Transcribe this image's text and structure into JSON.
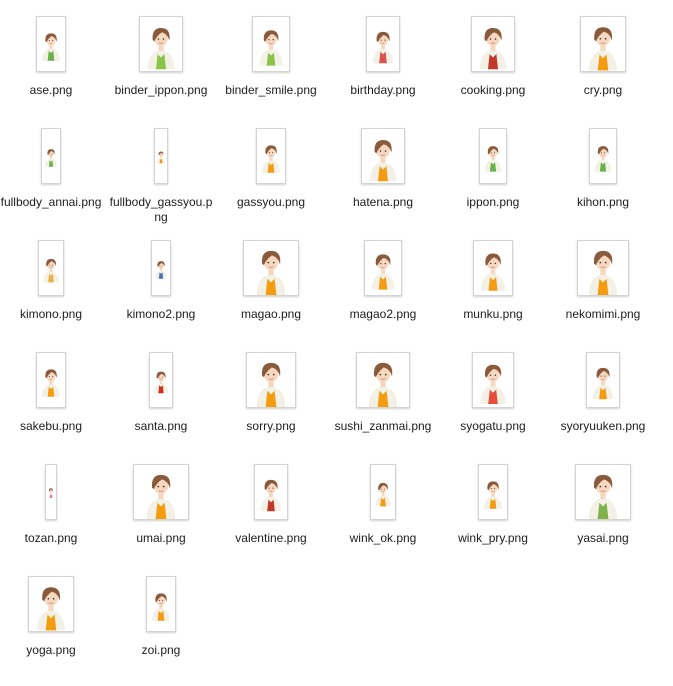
{
  "files": [
    {
      "name": "ase.png",
      "icon": "woman-portrait-green",
      "accent": "#6ab04c"
    },
    {
      "name": "binder_ippon.png",
      "icon": "woman-binder-pointing",
      "accent": "#8bc34a"
    },
    {
      "name": "binder_smile.png",
      "icon": "woman-binder-smile",
      "accent": "#8bc34a"
    },
    {
      "name": "birthday.png",
      "icon": "woman-birthday-cake",
      "accent": "#d9534f"
    },
    {
      "name": "cooking.png",
      "icon": "woman-cooking-pot",
      "accent": "#c0392b"
    },
    {
      "name": "cry.png",
      "icon": "woman-crying",
      "accent": "#f39c12"
    },
    {
      "name": "fullbody_annai.png",
      "icon": "woman-fullbody-guide",
      "accent": "#6ab04c"
    },
    {
      "name": "fullbody_gassyou.png",
      "icon": "woman-fullbody-praying",
      "accent": "#f39c12"
    },
    {
      "name": "gassyou.png",
      "icon": "woman-praying",
      "accent": "#f39c12"
    },
    {
      "name": "hatena.png",
      "icon": "woman-question",
      "accent": "#f39c12"
    },
    {
      "name": "ippon.png",
      "icon": "woman-finger-up",
      "accent": "#6ab04c"
    },
    {
      "name": "kihon.png",
      "icon": "woman-basic",
      "accent": "#6ab04c"
    },
    {
      "name": "kimono.png",
      "icon": "woman-kimono-gold",
      "accent": "#e6b34a"
    },
    {
      "name": "kimono2.png",
      "icon": "woman-kimono-blue",
      "accent": "#4a6fb5"
    },
    {
      "name": "magao.png",
      "icon": "woman-straight-face",
      "accent": "#f39c12"
    },
    {
      "name": "magao2.png",
      "icon": "woman-straight-face-2",
      "accent": "#f39c12"
    },
    {
      "name": "munku.png",
      "icon": "woman-complaining",
      "accent": "#f39c12"
    },
    {
      "name": "nekomimi.png",
      "icon": "woman-cat-ears",
      "accent": "#f39c12"
    },
    {
      "name": "sakebu.png",
      "icon": "woman-shouting",
      "accent": "#f39c12"
    },
    {
      "name": "santa.png",
      "icon": "woman-santa",
      "accent": "#d62d20"
    },
    {
      "name": "sorry.png",
      "icon": "woman-sorry",
      "accent": "#f39c12"
    },
    {
      "name": "sushi_zanmai.png",
      "icon": "woman-arms-wide",
      "accent": "#f39c12"
    },
    {
      "name": "syogatu.png",
      "icon": "woman-new-year",
      "accent": "#e74c3c"
    },
    {
      "name": "syoryuuken.png",
      "icon": "woman-uppercut",
      "accent": "#f39c12"
    },
    {
      "name": "tozan.png",
      "icon": "woman-hiking",
      "accent": "#e07aa0"
    },
    {
      "name": "umai.png",
      "icon": "woman-delicious",
      "accent": "#f39c12"
    },
    {
      "name": "valentine.png",
      "icon": "woman-valentine",
      "accent": "#c0392b"
    },
    {
      "name": "wink_ok.png",
      "icon": "woman-wink-ok",
      "accent": "#f39c12"
    },
    {
      "name": "wink_pry.png",
      "icon": "woman-wink-pray",
      "accent": "#f39c12"
    },
    {
      "name": "yasai.png",
      "icon": "woman-vegetables",
      "accent": "#7fb24a"
    },
    {
      "name": "yoga.png",
      "icon": "woman-yoga",
      "accent": "#f39c12"
    },
    {
      "name": "zoi.png",
      "icon": "woman-fist",
      "accent": "#f39c12"
    }
  ]
}
